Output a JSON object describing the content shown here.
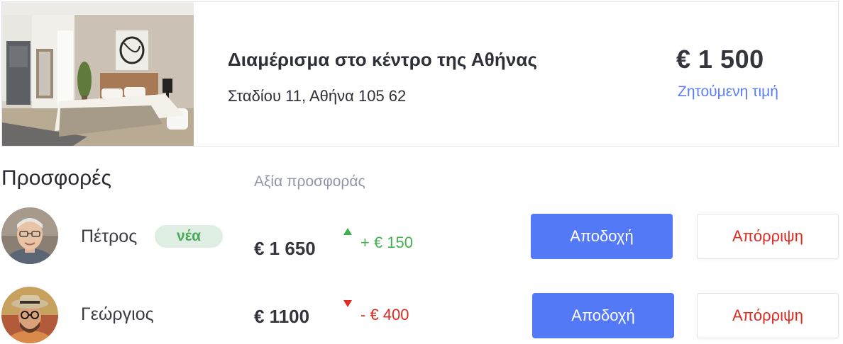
{
  "listing": {
    "title": "Διαμέρισμα στο κέντρο της Αθήνας",
    "address": "Σταδίου 11, Αθήνα 105 62",
    "price": "€ 1 500",
    "price_label": "Ζητούμενη τιμή"
  },
  "offers": {
    "title": "Προσφορές",
    "value_header": "Αξία προσφοράς",
    "items": [
      {
        "name": "Πέτρος",
        "badge": "νέα",
        "amount": "€ 1 650",
        "diff": "+ €  150",
        "trend": "up",
        "accept_label": "Αποδοχή",
        "reject_label": "Απόρριψη"
      },
      {
        "name": "Γεώργιος",
        "amount": "€  1100",
        "diff": "- €  400",
        "trend": "down",
        "accept_label": "Αποδοχή",
        "reject_label": "Απόρριψη"
      }
    ]
  },
  "colors": {
    "accent_blue": "#5479f7",
    "positive_green": "#3fb24f",
    "negative_red": "#e02a1f",
    "badge_bg": "#dfeee2"
  }
}
